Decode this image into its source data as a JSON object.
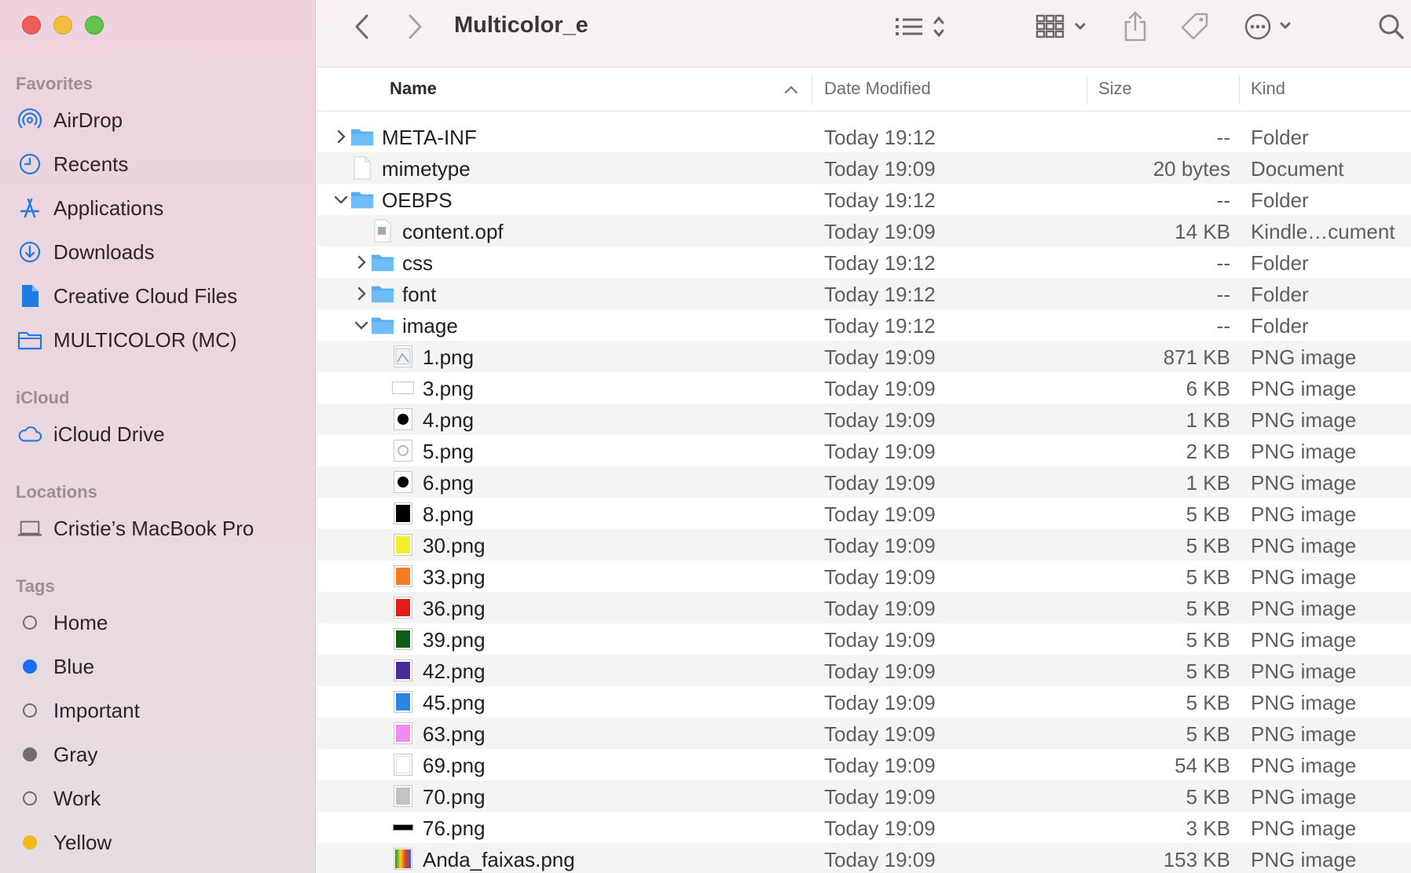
{
  "window": {
    "title": "Multicolor_e"
  },
  "sidebar": {
    "favorites_header": "Favorites",
    "favorites": [
      {
        "label": "AirDrop",
        "icon": "airdrop-icon"
      },
      {
        "label": "Recents",
        "icon": "clock-icon"
      },
      {
        "label": "Applications",
        "icon": "applications-icon"
      },
      {
        "label": "Downloads",
        "icon": "download-icon"
      },
      {
        "label": "Creative Cloud Files",
        "icon": "document-icon"
      },
      {
        "label": "MULTICOLOR (MC)",
        "icon": "folder-icon"
      }
    ],
    "icloud_header": "iCloud",
    "icloud": [
      {
        "label": "iCloud Drive",
        "icon": "cloud-icon"
      }
    ],
    "locations_header": "Locations",
    "locations": [
      {
        "label": "Cristie’s MacBook Pro",
        "icon": "laptop-icon"
      }
    ],
    "tags_header": "Tags",
    "tags": [
      {
        "label": "Home",
        "color": ""
      },
      {
        "label": "Blue",
        "color": "#1a6ef5"
      },
      {
        "label": "Important",
        "color": ""
      },
      {
        "label": "Gray",
        "color": "#6e6e70"
      },
      {
        "label": "Work",
        "color": ""
      },
      {
        "label": "Yellow",
        "color": "#f2b81c"
      }
    ]
  },
  "columns": {
    "name": "Name",
    "date": "Date Modified",
    "size": "Size",
    "kind": "Kind"
  },
  "files": [
    {
      "name": "META-INF",
      "date": "Today 19:12",
      "size": "--",
      "kind": "Folder",
      "level": 0,
      "type": "folder",
      "disclosure": "closed",
      "swatch": ""
    },
    {
      "name": "mimetype",
      "date": "Today 19:09",
      "size": "20 bytes",
      "kind": "Document",
      "level": 0,
      "type": "doc",
      "disclosure": "",
      "swatch": ""
    },
    {
      "name": "OEBPS",
      "date": "Today 19:12",
      "size": "--",
      "kind": "Folder",
      "level": 0,
      "type": "folder",
      "disclosure": "open",
      "swatch": ""
    },
    {
      "name": "content.opf",
      "date": "Today 19:09",
      "size": "14 KB",
      "kind": "Kindle…cument",
      "level": 1,
      "type": "opf",
      "disclosure": "",
      "swatch": ""
    },
    {
      "name": "css",
      "date": "Today 19:12",
      "size": "--",
      "kind": "Folder",
      "level": 1,
      "type": "folder",
      "disclosure": "closed",
      "swatch": ""
    },
    {
      "name": "font",
      "date": "Today 19:12",
      "size": "--",
      "kind": "Folder",
      "level": 1,
      "type": "folder",
      "disclosure": "closed",
      "swatch": ""
    },
    {
      "name": "image",
      "date": "Today 19:12",
      "size": "--",
      "kind": "Folder",
      "level": 1,
      "type": "folder",
      "disclosure": "open",
      "swatch": ""
    },
    {
      "name": "1.png",
      "date": "Today 19:09",
      "size": "871 KB",
      "kind": "PNG image",
      "level": 2,
      "type": "png",
      "disclosure": "",
      "swatch": "pic"
    },
    {
      "name": "3.png",
      "date": "Today 19:09",
      "size": "6 KB",
      "kind": "PNG image",
      "level": 2,
      "type": "png",
      "disclosure": "",
      "swatch": "wide"
    },
    {
      "name": "4.png",
      "date": "Today 19:09",
      "size": "1 KB",
      "kind": "PNG image",
      "level": 2,
      "type": "png",
      "disclosure": "",
      "swatch": "dot"
    },
    {
      "name": "5.png",
      "date": "Today 19:09",
      "size": "2 KB",
      "kind": "PNG image",
      "level": 2,
      "type": "png",
      "disclosure": "",
      "swatch": "ring"
    },
    {
      "name": "6.png",
      "date": "Today 19:09",
      "size": "1 KB",
      "kind": "PNG image",
      "level": 2,
      "type": "png",
      "disclosure": "",
      "swatch": "dot"
    },
    {
      "name": "8.png",
      "date": "Today 19:09",
      "size": "5 KB",
      "kind": "PNG image",
      "level": 2,
      "type": "png",
      "disclosure": "",
      "swatch": "#000000"
    },
    {
      "name": "30.png",
      "date": "Today 19:09",
      "size": "5 KB",
      "kind": "PNG image",
      "level": 2,
      "type": "png",
      "disclosure": "",
      "swatch": "#f2ee2a"
    },
    {
      "name": "33.png",
      "date": "Today 19:09",
      "size": "5 KB",
      "kind": "PNG image",
      "level": 2,
      "type": "png",
      "disclosure": "",
      "swatch": "#f47b20"
    },
    {
      "name": "36.png",
      "date": "Today 19:09",
      "size": "5 KB",
      "kind": "PNG image",
      "level": 2,
      "type": "png",
      "disclosure": "",
      "swatch": "#e31b1b"
    },
    {
      "name": "39.png",
      "date": "Today 19:09",
      "size": "5 KB",
      "kind": "PNG image",
      "level": 2,
      "type": "png",
      "disclosure": "",
      "swatch": "#0e5c16"
    },
    {
      "name": "42.png",
      "date": "Today 19:09",
      "size": "5 KB",
      "kind": "PNG image",
      "level": 2,
      "type": "png",
      "disclosure": "",
      "swatch": "#4b2a9a"
    },
    {
      "name": "45.png",
      "date": "Today 19:09",
      "size": "5 KB",
      "kind": "PNG image",
      "level": 2,
      "type": "png",
      "disclosure": "",
      "swatch": "#2a86e0"
    },
    {
      "name": "63.png",
      "date": "Today 19:09",
      "size": "5 KB",
      "kind": "PNG image",
      "level": 2,
      "type": "png",
      "disclosure": "",
      "swatch": "#f08ef0"
    },
    {
      "name": "69.png",
      "date": "Today 19:09",
      "size": "54 KB",
      "kind": "PNG image",
      "level": 2,
      "type": "png",
      "disclosure": "",
      "swatch": "#ffffff"
    },
    {
      "name": "70.png",
      "date": "Today 19:09",
      "size": "5 KB",
      "kind": "PNG image",
      "level": 2,
      "type": "png",
      "disclosure": "",
      "swatch": "#c3c3c3"
    },
    {
      "name": "76.png",
      "date": "Today 19:09",
      "size": "3 KB",
      "kind": "PNG image",
      "level": 2,
      "type": "png",
      "disclosure": "",
      "swatch": "bar"
    },
    {
      "name": "Anda_faixas.png",
      "date": "Today 19:09",
      "size": "153 KB",
      "kind": "PNG image",
      "level": 2,
      "type": "png",
      "disclosure": "",
      "swatch": "rainbow"
    }
  ]
}
